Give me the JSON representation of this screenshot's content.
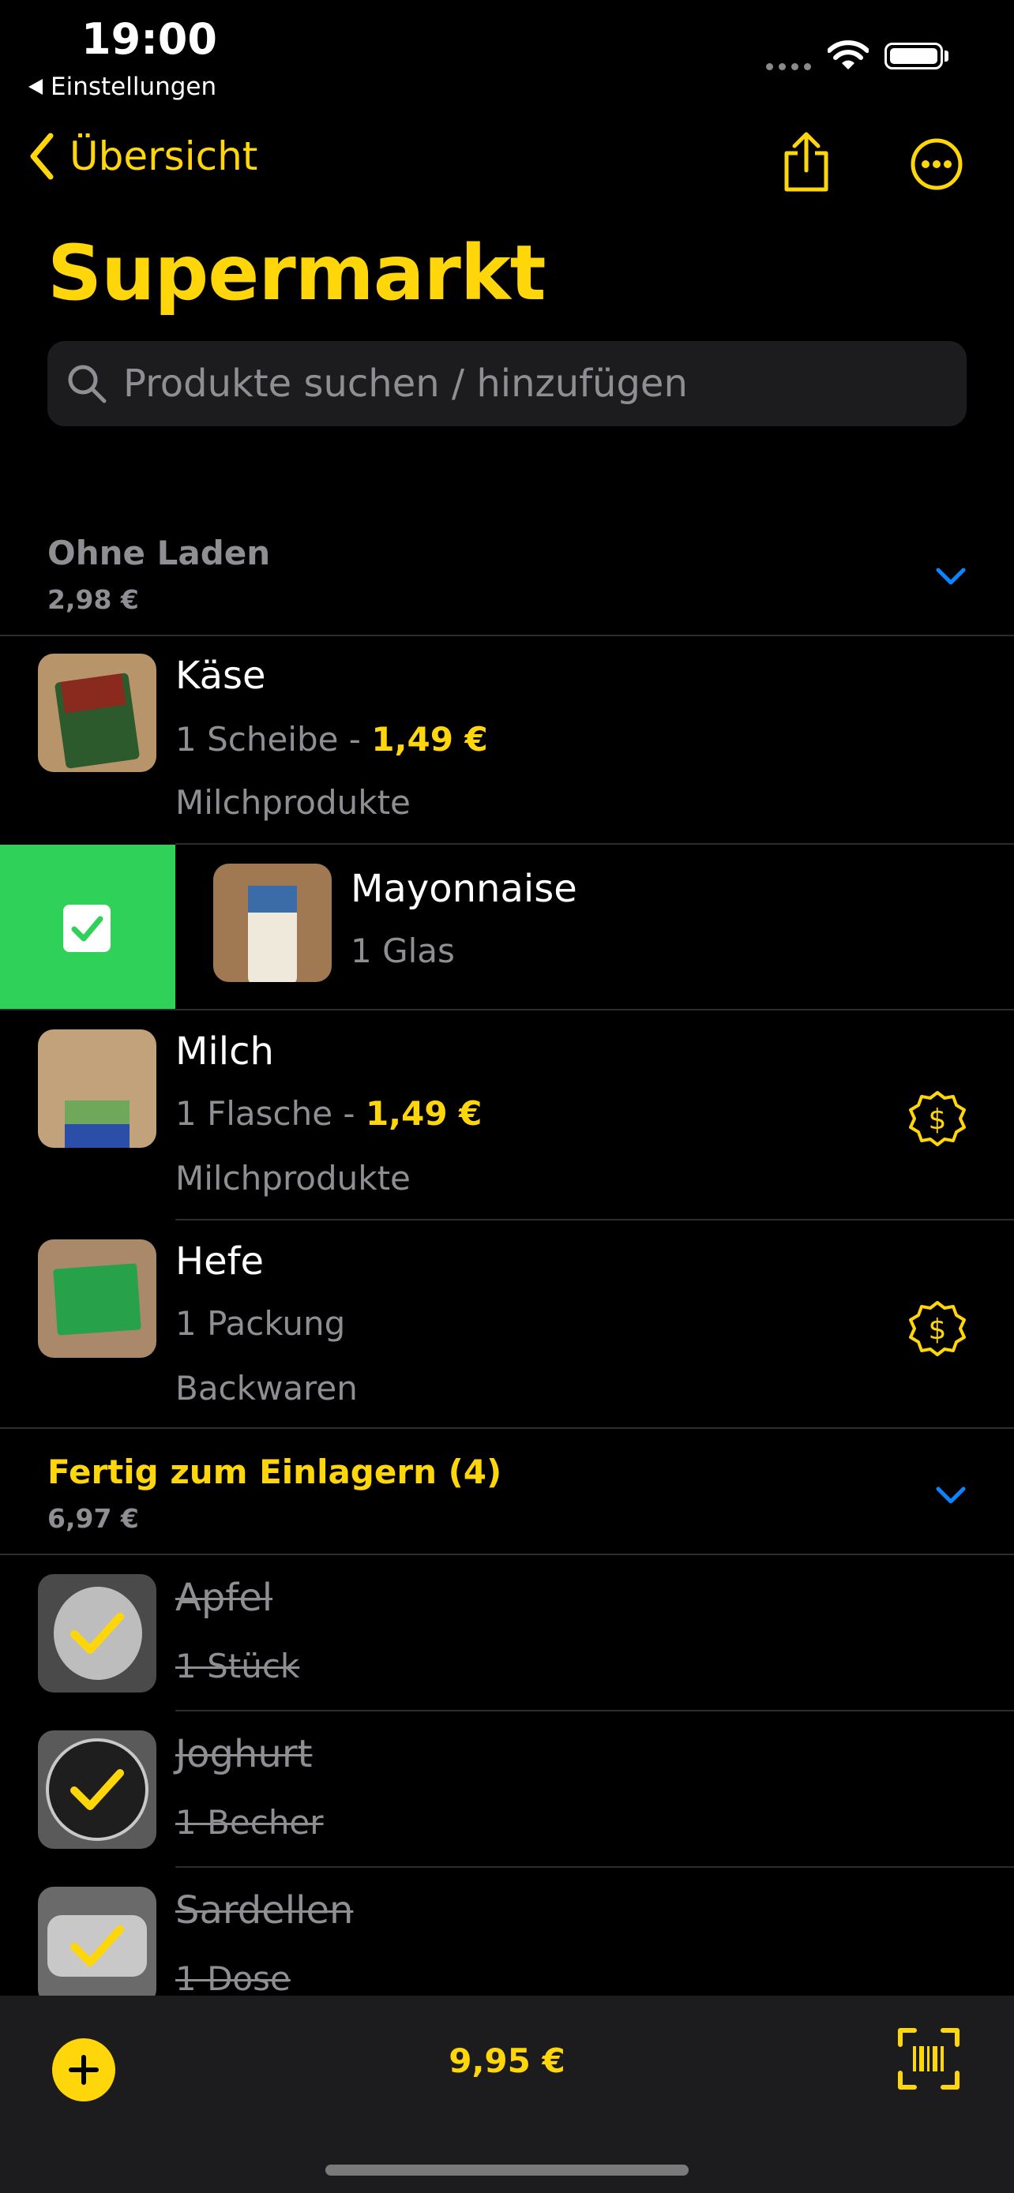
{
  "status": {
    "time": "19:00",
    "back_app": "Einstellungen"
  },
  "nav": {
    "back_label": "Übersicht",
    "share_icon": "share-icon",
    "more_icon": "ellipsis-circle-icon"
  },
  "page": {
    "title": "Supermarkt"
  },
  "search": {
    "placeholder": "Produkte suchen / hinzufügen"
  },
  "sections": [
    {
      "title": "Ohne Laden",
      "subtotal": "2,98 €"
    },
    {
      "title": "Fertig zum Einlagern (4)",
      "subtotal": "6,97 €"
    }
  ],
  "items": [
    {
      "name": "Käse",
      "qty": "1 Scheibe",
      "sep": " - ",
      "price": "1,49 €",
      "category": "Milchprodukte"
    },
    {
      "name": "Mayonnaise",
      "qty": "1 Glas"
    },
    {
      "name": "Milch",
      "qty": "1 Flasche",
      "sep": " - ",
      "price": "1,49 €",
      "category": "Milchprodukte"
    },
    {
      "name": "Hefe",
      "qty": "1 Packung",
      "category": "Backwaren"
    }
  ],
  "done_items": [
    {
      "name": "Apfel",
      "qty": "1 Stück"
    },
    {
      "name": "Joghurt",
      "qty": "1 Becher"
    },
    {
      "name": "Sardellen",
      "qty": "1 Dose"
    }
  ],
  "bottom": {
    "total": "9,95 €",
    "add_icon": "plus-circle-icon",
    "scan_icon": "barcode-scan-icon"
  },
  "colors": {
    "accent": "#ffd60a",
    "swipe_action": "#30d158",
    "chevron": "#0a84ff"
  }
}
